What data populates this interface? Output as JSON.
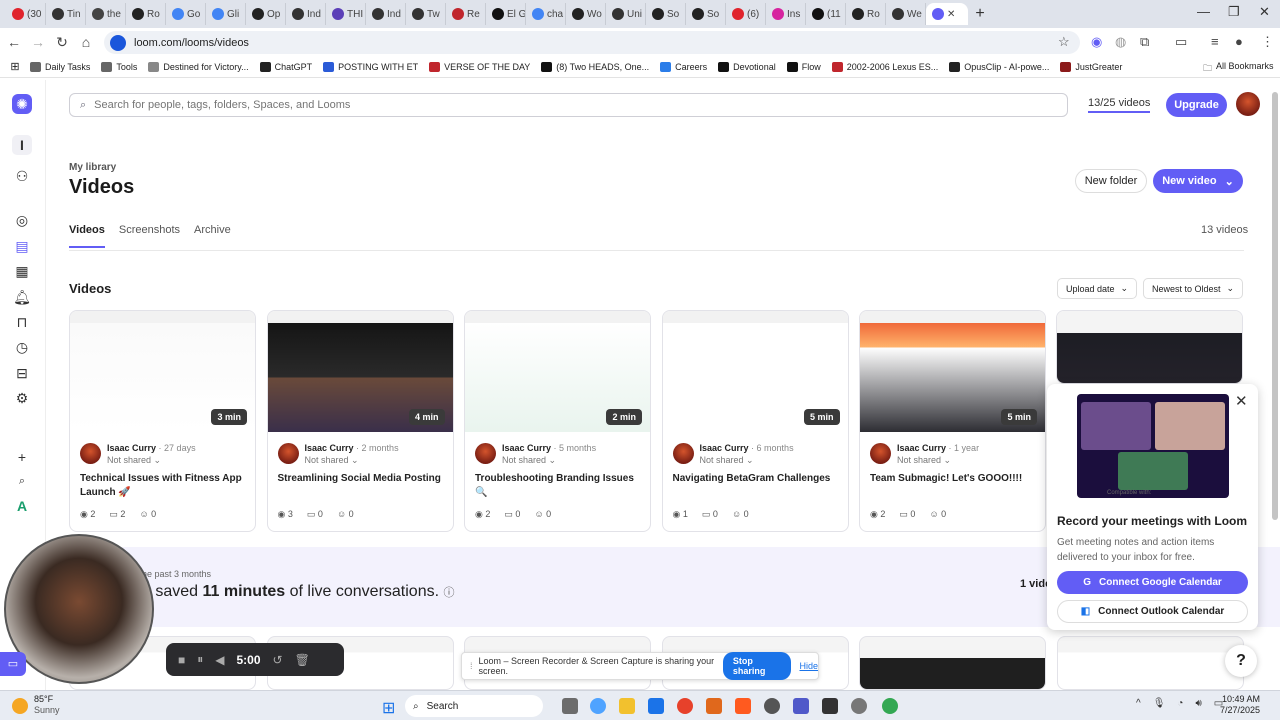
{
  "browser": {
    "tabs": [
      {
        "label": "(30",
        "color": "#e0242d"
      },
      {
        "label": "Tin",
        "color": "#333333"
      },
      {
        "label": "the",
        "color": "#444444"
      },
      {
        "label": "Ro",
        "color": "#222222"
      },
      {
        "label": "Go",
        "color": "#4285f4"
      },
      {
        "label": "Gli",
        "color": "#4285f4"
      },
      {
        "label": "Op",
        "color": "#222222"
      },
      {
        "label": "Ind",
        "color": "#333333"
      },
      {
        "label": "THI",
        "color": "#5b3fb8"
      },
      {
        "label": "Ind",
        "color": "#333333"
      },
      {
        "label": "Tw",
        "color": "#333333"
      },
      {
        "label": "Re",
        "color": "#c0262d"
      },
      {
        "label": "El G",
        "color": "#111111"
      },
      {
        "label": "cha",
        "color": "#4285f4"
      },
      {
        "label": "Wo",
        "color": "#222222"
      },
      {
        "label": "Uni",
        "color": "#333333"
      },
      {
        "label": "So",
        "color": "#222222"
      },
      {
        "label": "So",
        "color": "#222222"
      },
      {
        "label": "(6)",
        "color": "#e0242d"
      },
      {
        "label": "Ins",
        "color": "#d6249f"
      },
      {
        "label": "(11",
        "color": "#111111"
      },
      {
        "label": "Ro",
        "color": "#222222"
      },
      {
        "label": "We",
        "color": "#333333"
      }
    ],
    "active_tab_label": "",
    "url": "loom.com/looms/videos",
    "bookmarks": [
      {
        "label": "Daily Tasks",
        "color": "#666666"
      },
      {
        "label": "Tools",
        "color": "#666666"
      },
      {
        "label": "Destined for Victory...",
        "color": "#888888"
      },
      {
        "label": "ChatGPT",
        "color": "#222222"
      },
      {
        "label": "POSTING WITH ET",
        "color": "#2b5bd7"
      },
      {
        "label": "VERSE OF THE DAY",
        "color": "#c0262d"
      },
      {
        "label": "(8) Two HEADS, One...",
        "color": "#111111"
      },
      {
        "label": "Careers",
        "color": "#2b7de9"
      },
      {
        "label": "Devotional",
        "color": "#111111"
      },
      {
        "label": "Flow",
        "color": "#111111"
      },
      {
        "label": "2002-2006 Lexus ES...",
        "color": "#c0262d"
      },
      {
        "label": "OpusClip - AI-powe...",
        "color": "#222222"
      },
      {
        "label": "JustGreater",
        "color": "#8b1a1a"
      }
    ],
    "all_bookmarks": "All Bookmarks"
  },
  "app": {
    "accent": "#625df5",
    "search_placeholder": "Search for people, tags, folders, Spaces, and Looms",
    "video_count": "13/25 videos",
    "upgrade": "Upgrade",
    "breadcrumb": "My library",
    "title": "Videos",
    "new_folder": "New folder",
    "new_video": "New video",
    "tabs": [
      "Videos",
      "Screenshots",
      "Archive"
    ],
    "total": "13 videos",
    "section_title": "Videos",
    "sort_by": "Upload date",
    "sort_order": "Newest to Oldest"
  },
  "cards": [
    {
      "duration": "3 min",
      "author": "Isaac Curry",
      "ago": "27 days",
      "shared": "Not shared",
      "title": "Technical Issues with Fitness App Launch 🚀",
      "views": "2",
      "comments": "2",
      "reactions": "0"
    },
    {
      "duration": "4 min",
      "author": "Isaac Curry",
      "ago": "2 months",
      "shared": "Not shared",
      "title": "Streamlining Social Media Posting",
      "views": "3",
      "comments": "0",
      "reactions": "0"
    },
    {
      "duration": "2 min",
      "author": "Isaac Curry",
      "ago": "5 months",
      "shared": "Not shared",
      "title": "Troubleshooting Branding Issues 🔍",
      "views": "2",
      "comments": "0",
      "reactions": "0"
    },
    {
      "duration": "5 min",
      "author": "Isaac Curry",
      "ago": "6 months",
      "shared": "Not shared",
      "title": "Navigating BetaGram Challenges",
      "views": "1",
      "comments": "0",
      "reactions": "0"
    },
    {
      "duration": "5 min",
      "author": "Isaac Curry",
      "ago": "1 year",
      "shared": "Not shared",
      "title": "Team Submagic! Let's GOOO!!!!",
      "views": "2",
      "comments": "0",
      "reactions": "0"
    }
  ],
  "banner": {
    "period": "he past 3 months",
    "saved_prefix": "u saved ",
    "saved_value": "11 minutes",
    "saved_suffix": " of live conversations.",
    "right": "1 vide"
  },
  "recorder": {
    "time": "5:00"
  },
  "sharing": {
    "message": "Loom – Screen Recorder & Screen Capture is sharing your screen.",
    "stop": "Stop sharing",
    "hide": "Hide"
  },
  "popup": {
    "title": "Record your meetings with Loom",
    "desc": "Get meeting notes and action items delivered to your inbox for free.",
    "google": "Connect Google Calendar",
    "outlook": "Connect Outlook Calendar",
    "caption": "Compatible with:"
  },
  "taskbar": {
    "temp": "85°F",
    "weather": "Sunny",
    "search": "Search",
    "time": "10:49 AM",
    "date": "7/27/2025"
  }
}
